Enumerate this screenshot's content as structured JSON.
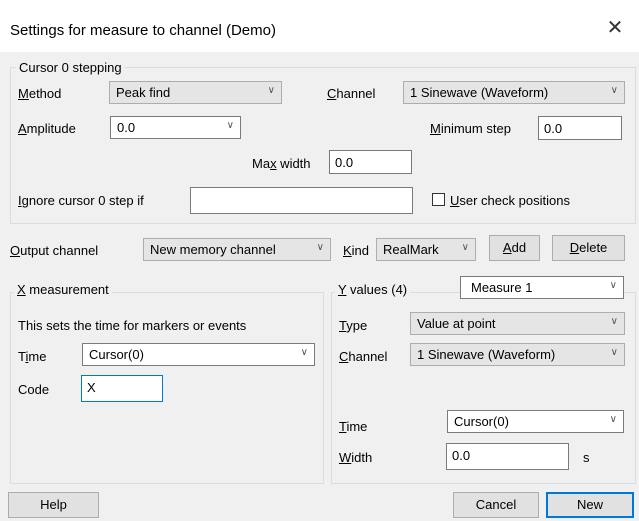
{
  "window": {
    "title": "Settings for measure to channel (Demo)",
    "close_glyph": "✕"
  },
  "cursor_group": {
    "title": "Cursor 0 stepping",
    "method": {
      "label_key": "M",
      "label_rest": "ethod",
      "value": "Peak find"
    },
    "channel": {
      "label_key": "C",
      "label_rest": "hannel",
      "value": "1 Sinewave (Waveform)"
    },
    "amplitude": {
      "label_key": "A",
      "label_rest": "mplitude",
      "value": "0.0"
    },
    "min_step": {
      "label_key": "M",
      "label_rest": "inimum step",
      "value": "0.0"
    },
    "max_width": {
      "label_pre": "Ma",
      "label_key": "x",
      "label_rest": " width",
      "value": "0.0"
    },
    "ignore": {
      "label_key": "I",
      "label_rest": "gnore cursor 0 step if",
      "value": ""
    },
    "user_check": {
      "label_key": "U",
      "label_rest": "ser check positions",
      "checked": false
    }
  },
  "output": {
    "channel": {
      "label_key": "O",
      "label_rest": "utput channel",
      "value": "New memory channel"
    },
    "kind": {
      "label_key": "K",
      "label_rest": "ind",
      "value": "RealMark"
    },
    "add_key": "A",
    "add_rest": "dd",
    "delete_key": "D",
    "delete_rest": "elete"
  },
  "x_group": {
    "title_key": "X",
    "title_rest": " measurement",
    "description": "This sets the time for markers or events",
    "time": {
      "label_pre": "T",
      "label_key": "i",
      "label_rest": "me",
      "value": "Cursor(0)"
    },
    "code": {
      "label": "Code",
      "value": "X"
    }
  },
  "y_group": {
    "title_key": "Y",
    "title_rest": " values (4)",
    "measure_value": "Measure 1",
    "type": {
      "label_key": "T",
      "label_rest": "ype",
      "value": "Value at point"
    },
    "channel": {
      "label_key": "C",
      "label_rest": "hannel",
      "value": "1 Sinewave (Waveform)"
    },
    "time": {
      "label_key": "T",
      "label_rest": "ime",
      "value": "Cursor(0)"
    },
    "width": {
      "label_key": "W",
      "label_rest": "idth",
      "value": "0.0",
      "unit": "s"
    }
  },
  "footer": {
    "help": "Help",
    "cancel": "Cancel",
    "new": "New"
  },
  "icons": {
    "dropdown": "chevron-down-icon",
    "close": "close-icon"
  }
}
